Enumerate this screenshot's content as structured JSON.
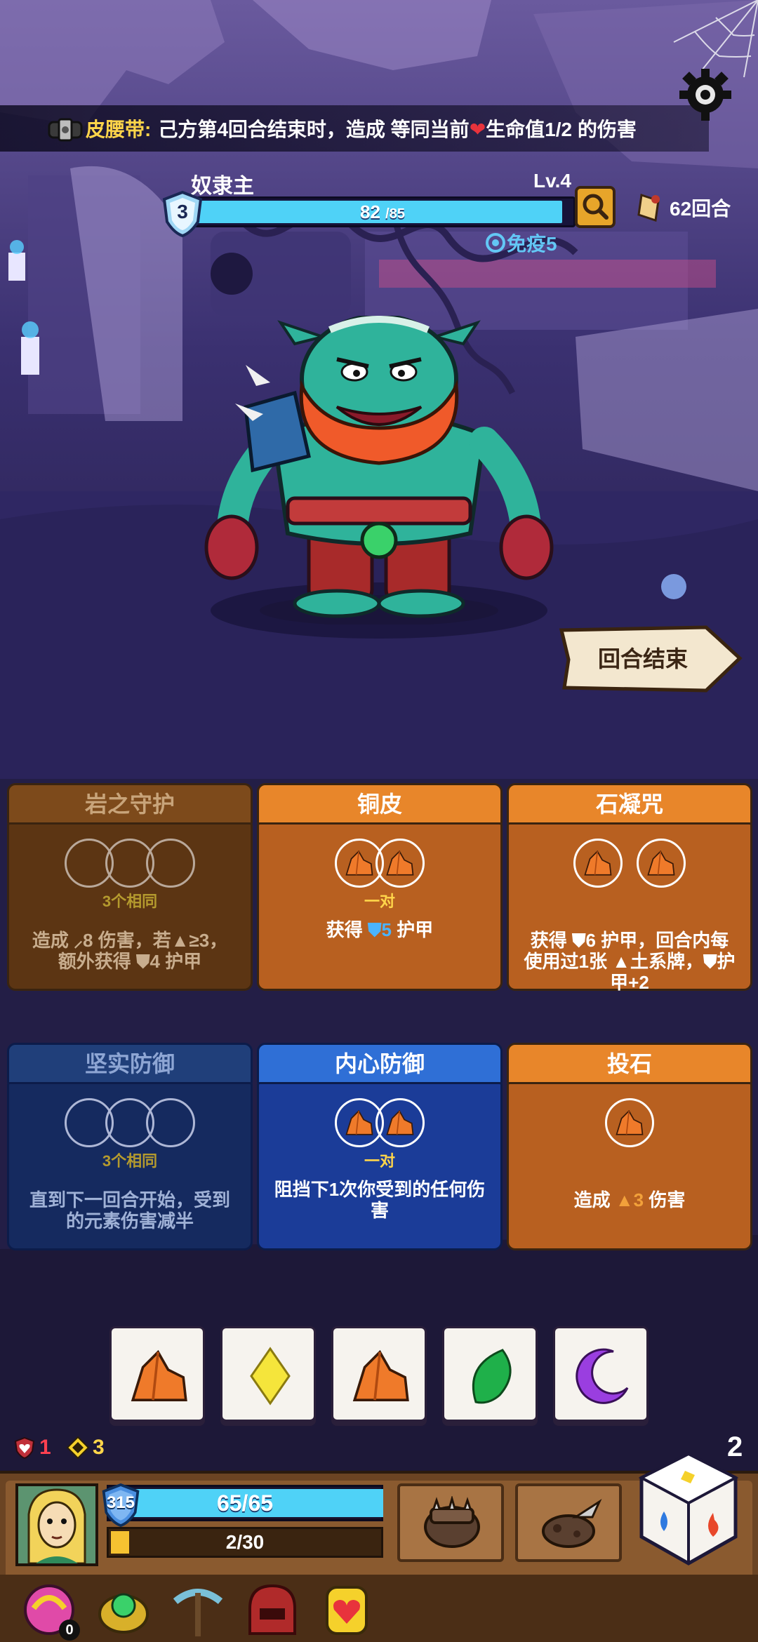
{
  "buff": {
    "name": "皮腰带:",
    "text_before": "己方第4回合结束时，造成 等同当前",
    "text_after": "生命值1/2 的伤害",
    "icon": "belt-icon"
  },
  "enemy": {
    "name": "奴隶主",
    "level": "Lv.4",
    "shield": "3",
    "hp_current": "82",
    "hp_max": "/85",
    "hp_fraction": 0.965,
    "immunity": "免疫5"
  },
  "turn": {
    "label": "62回合",
    "icon": "scroll-icon"
  },
  "end_turn_label": "回合结束",
  "cards": [
    {
      "title": "岩之守护",
      "style": "orange-dim",
      "slots": 3,
      "slot_icon": "",
      "requirement": "3个相同",
      "effect_line1": "造成 ⸝8 伤害，若▲≥3，",
      "effect_line2": "额外获得 ⛊4 护甲"
    },
    {
      "title": "铜皮",
      "style": "orange",
      "slots": 2,
      "slot_icon": "rock-icon",
      "requirement": "一对",
      "effect_prefix": "获得 ",
      "effect_value": "5",
      "effect_suffix": " 护甲"
    },
    {
      "title": "石凝咒",
      "style": "orange",
      "slots": 2,
      "slot_icon": "rock-icon",
      "requirement": "",
      "effect_line1": "获得 ⛊6 护甲，回合内每",
      "effect_line2": "使用过1张 ▲土系牌，⛊护",
      "effect_line3": "甲+2"
    },
    {
      "title": "坚实防御",
      "style": "blue-dim",
      "slots": 3,
      "slot_icon": "",
      "requirement": "3个相同",
      "effect_line1": "直到下一回合开始，受到",
      "effect_line2": "的元素伤害减半"
    },
    {
      "title": "内心防御",
      "style": "blue",
      "slots": 2,
      "slot_icon": "rock-icon",
      "requirement": "一对",
      "effect_line1": "阻挡下1次你受到的任何伤",
      "effect_line2": "害"
    },
    {
      "title": "投石",
      "style": "orange",
      "slots": 1,
      "slot_icon": "rock-icon",
      "requirement": "",
      "effect_prefix": "造成 ",
      "effect_value": "3",
      "effect_suffix": " 伤害"
    }
  ],
  "dice": [
    {
      "face": "rock-icon",
      "color": "#ef7a2a"
    },
    {
      "face": "diamond-icon",
      "color": "#f5e53b"
    },
    {
      "face": "rock-icon",
      "color": "#ef7a2a"
    },
    {
      "face": "leaf-icon",
      "color": "#1fb04a"
    },
    {
      "face": "moon-icon",
      "color": "#9a3ee0"
    }
  ],
  "player": {
    "hearts": "1",
    "energy": "3",
    "shield": "315",
    "hp": "65/65",
    "hp_fraction": 1.0,
    "xp": "2/30",
    "xp_fraction": 0.0667,
    "dice_count": "2"
  },
  "relics": [
    {
      "name": "pink-orb-icon",
      "badge": "0"
    },
    {
      "name": "green-orb-icon",
      "badge": ""
    },
    {
      "name": "pickaxe-icon",
      "badge": ""
    },
    {
      "name": "red-helmet-icon",
      "badge": ""
    },
    {
      "name": "heart-amulet-icon",
      "badge": ""
    }
  ],
  "colors": {
    "hp_bar": "#4fd2f7",
    "xp_bar": "#f6c231",
    "buff_name": "#ffd54a",
    "immunity": "#63c7f5"
  }
}
